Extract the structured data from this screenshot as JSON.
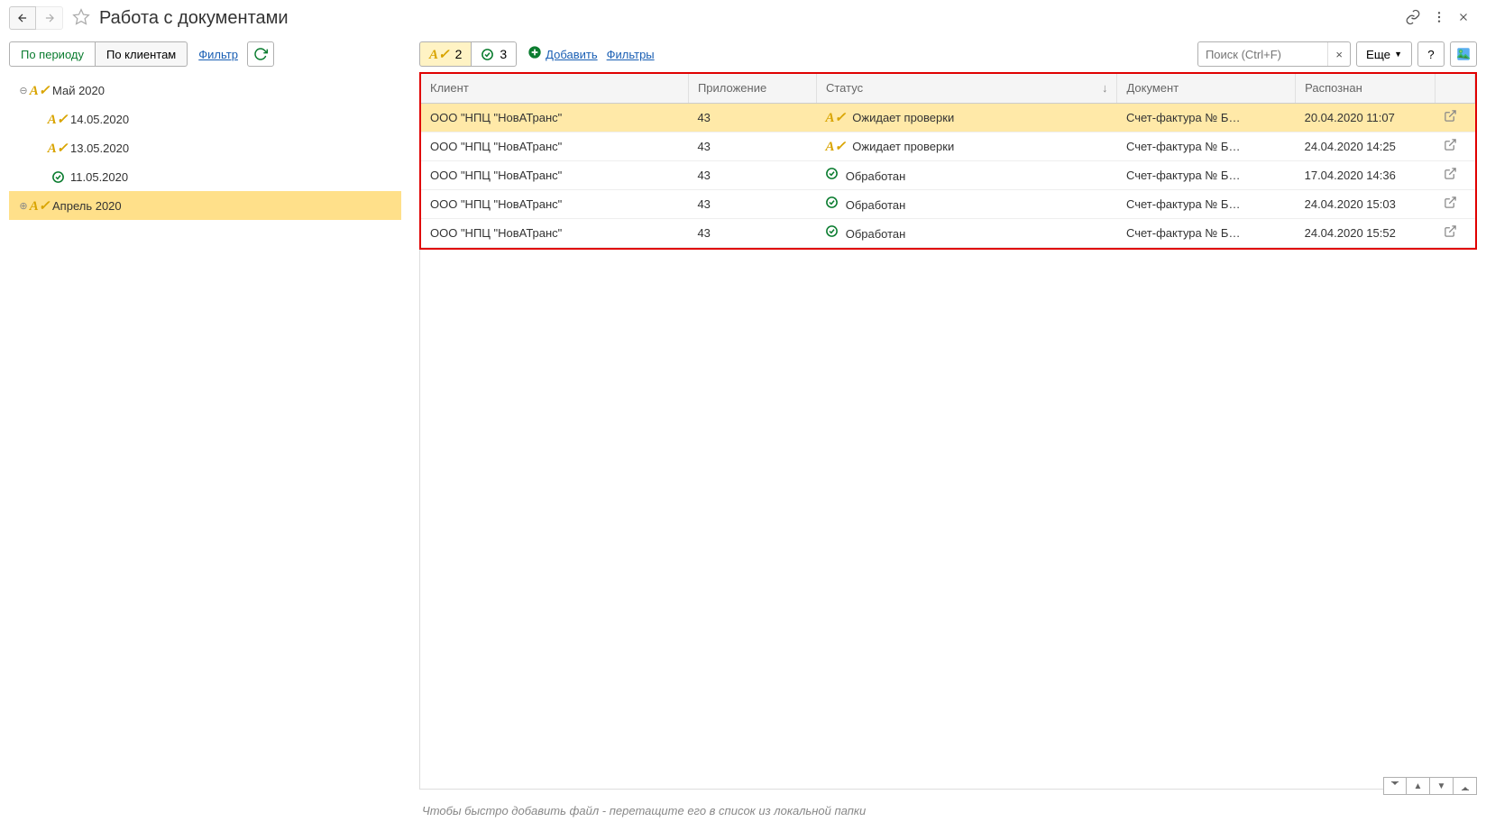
{
  "header": {
    "title": "Работа с документами"
  },
  "sidebar": {
    "tabs": {
      "period": "По периоду",
      "clients": "По клиентам"
    },
    "filter_link": "Фильтр",
    "tree": [
      {
        "label": "Май 2020",
        "type": "pending",
        "expanded": true,
        "children": [
          {
            "label": "14.05.2020",
            "type": "pending"
          },
          {
            "label": "13.05.2020",
            "type": "pending"
          },
          {
            "label": "11.05.2020",
            "type": "done"
          }
        ]
      },
      {
        "label": "Апрель 2020",
        "type": "pending",
        "expanded": false,
        "selected": true
      }
    ]
  },
  "maintb": {
    "pending_count": "2",
    "done_count": "3",
    "add_link": "Добавить",
    "filters_link": "Фильтры",
    "search_ph": "Поиск (Ctrl+F)",
    "more_label": "Еще",
    "help_label": "?"
  },
  "table": {
    "headers": {
      "client": "Клиент",
      "app": "Приложение",
      "status": "Статус",
      "doc": "Документ",
      "recognized": "Распознан"
    },
    "rows": [
      {
        "client": "ООО \"НПЦ \"НовАТранс\"",
        "app": "43",
        "status": "Ожидает проверки",
        "status_type": "pending",
        "doc": "Счет-фактура № Б…",
        "recognized": "20.04.2020 11:07",
        "sel": true
      },
      {
        "client": "ООО \"НПЦ \"НовАТранс\"",
        "app": "43",
        "status": "Ожидает проверки",
        "status_type": "pending",
        "doc": "Счет-фактура № Б…",
        "recognized": "24.04.2020 14:25"
      },
      {
        "client": "ООО \"НПЦ \"НовАТранс\"",
        "app": "43",
        "status": "Обработан",
        "status_type": "done",
        "doc": "Счет-фактура № Б…",
        "recognized": "17.04.2020 14:36"
      },
      {
        "client": "ООО \"НПЦ \"НовАТранс\"",
        "app": "43",
        "status": "Обработан",
        "status_type": "done",
        "doc": "Счет-фактура № Б…",
        "recognized": "24.04.2020 15:03"
      },
      {
        "client": "ООО \"НПЦ \"НовАТранс\"",
        "app": "43",
        "status": "Обработан",
        "status_type": "done",
        "doc": "Счет-фактура № Б…",
        "recognized": "24.04.2020 15:52"
      }
    ]
  },
  "footer": {
    "hint": "Чтобы быстро добавить файл - перетащите его в список из локальной папки"
  }
}
